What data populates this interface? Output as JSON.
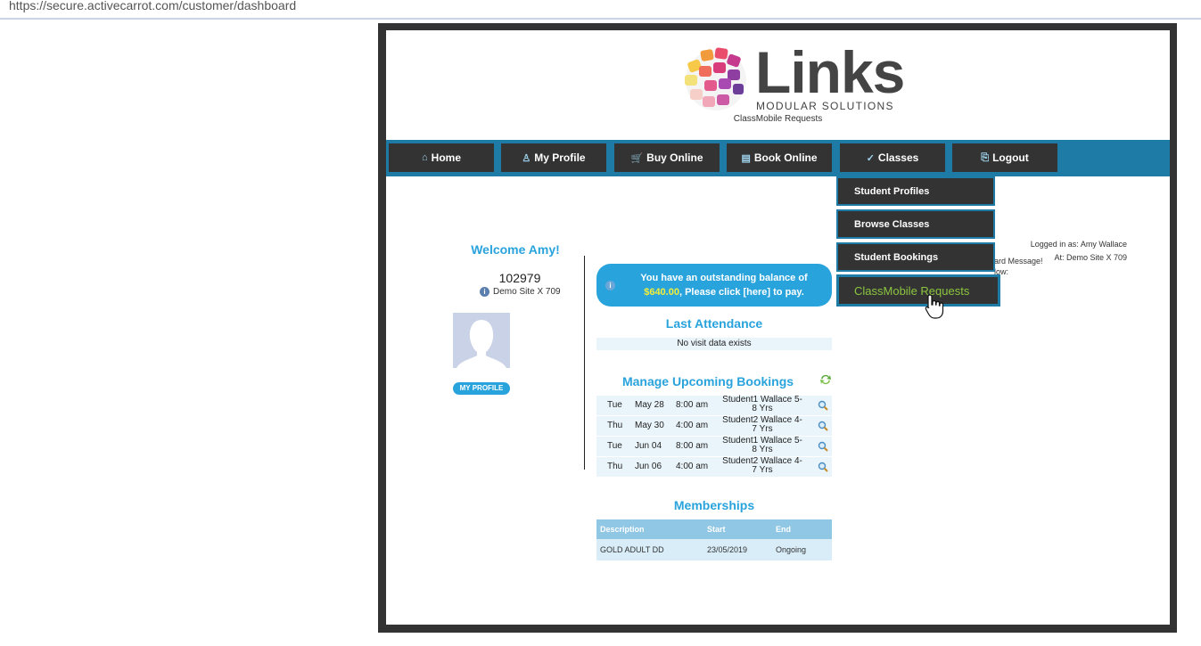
{
  "browser": {
    "url": "https://secure.activecarrot.com/customer/dashboard"
  },
  "header": {
    "logo_title": "Links",
    "logo_subtitle": "MODULAR SOLUTIONS",
    "page_subtitle": "ClassMobile Requests"
  },
  "nav": {
    "items": [
      {
        "label": "Home",
        "icon": "home-icon"
      },
      {
        "label": "My Profile",
        "icon": "profile-icon"
      },
      {
        "label": "Buy Online",
        "icon": "cart-icon"
      },
      {
        "label": "Book Online",
        "icon": "calendar-icon"
      },
      {
        "label": "Classes",
        "icon": "classes-icon"
      },
      {
        "label": "Logout",
        "icon": "logout-icon"
      }
    ]
  },
  "classes_menu": {
    "items": [
      {
        "label": "Student Profiles"
      },
      {
        "label": "Browse Classes"
      },
      {
        "label": "Student Bookings"
      },
      {
        "label": "ClassMobile Requests"
      }
    ]
  },
  "profile": {
    "welcome": "Welcome Amy!",
    "member_id": "102979",
    "site": "Demo Site X 709",
    "profile_button": "MY PROFILE"
  },
  "balance": {
    "before": "You have an outstanding balance of",
    "amount": "$640.00",
    "after": ", Please click [here] to pay."
  },
  "attendance": {
    "title": "Last Attendance",
    "empty": "No visit data exists"
  },
  "bookings": {
    "title": "Manage Upcoming Bookings",
    "rows": [
      {
        "day": "Tue",
        "date": "May 28",
        "time": "8:00 am",
        "student": "Student1 Wallace 5-8 Yrs"
      },
      {
        "day": "Thu",
        "date": "May 30",
        "time": "4:00 am",
        "student": "Student2 Wallace 4-7 Yrs"
      },
      {
        "day": "Tue",
        "date": "Jun 04",
        "time": "8:00 am",
        "student": "Student1 Wallace 5-8 Yrs"
      },
      {
        "day": "Thu",
        "date": "Jun 06",
        "time": "4:00 am",
        "student": "Student2 Wallace 4-7 Yrs"
      }
    ]
  },
  "memberships": {
    "title": "Memberships",
    "headers": {
      "description": "Description",
      "start": "Start",
      "end": "End"
    },
    "rows": [
      {
        "description": "GOLD ADULT DD",
        "start": "23/05/2019",
        "end": "Ongoing"
      }
    ]
  },
  "session": {
    "logged_in": "Logged in as: Amy Wallace",
    "site": "At: Demo Site X 709",
    "board_line1": "ard Message!",
    "board_line2": "low:"
  },
  "colors": {
    "accent": "#29a3dc",
    "nav_bar": "#1e7ba5",
    "nav_button": "#333333",
    "active_menu_text": "#8cc63f",
    "balance_amount": "#f3ef38"
  }
}
